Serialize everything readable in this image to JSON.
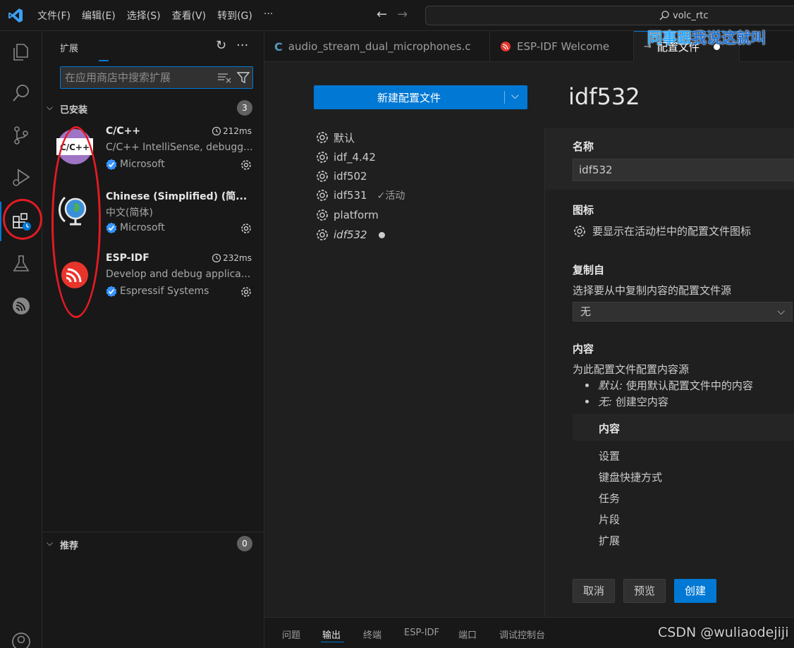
{
  "titlebar": {
    "menus": [
      "文件(F)",
      "编辑(E)",
      "选择(S)",
      "查看(V)",
      "转到(G)",
      "···"
    ],
    "back_arrow": "←",
    "forward_arrow": "→",
    "search_text": "volc_rtc",
    "logo_icon": "vscode-logo-icon"
  },
  "activitybar": {
    "items": [
      "explorer-icon",
      "search-icon",
      "source-control-icon",
      "run-debug-icon",
      "extensions-icon",
      "testing-icon",
      "espressif-icon",
      "account-icon"
    ],
    "active_color": "#0078d4"
  },
  "sidebar": {
    "title": "扩展",
    "refresh_icon": "↻",
    "more_icon": "···",
    "search_placeholder": "在应用商店中搜索扩展",
    "installed": {
      "label": "已安装",
      "count": "3",
      "items": [
        {
          "name": "C/C++",
          "time": "212ms",
          "desc": "C/C++ IntelliSense, debugg...",
          "publisher": "Microsoft",
          "icon_text": "C/C++"
        },
        {
          "name": "Chinese (Simplified) (简...",
          "time": "",
          "desc": "中文(简体)",
          "publisher": "Microsoft"
        },
        {
          "name": "ESP-IDF",
          "time": "232ms",
          "desc": "Develop and debug applica...",
          "publisher": "Espressif Systems"
        }
      ]
    },
    "recommended": {
      "label": "推荐",
      "count": "0"
    }
  },
  "tabs": [
    {
      "label": "audio_stream_dual_microphones.c",
      "icon": "C"
    },
    {
      "label": "ESP-IDF Welcome"
    },
    {
      "label": "配置文件"
    }
  ],
  "overlay": {
    "part1": "同事跟",
    "part2": "我说这就叫"
  },
  "editor": {
    "new_profile_button": "新建配置文件",
    "profiles": [
      {
        "name": "默认",
        "active_label": ""
      },
      {
        "name": "idf_4.42",
        "active_label": ""
      },
      {
        "name": "idf502",
        "active_label": ""
      },
      {
        "name": "idf531",
        "active_label": "活动"
      },
      {
        "name": "platform",
        "active_label": ""
      },
      {
        "name": "idf532",
        "active_label": ""
      }
    ],
    "check_mark": "✓",
    "title": "idf532",
    "name_label": "名称",
    "name_value": "idf532",
    "icon_label": "图标",
    "icon_desc": "要显示在活动栏中的配置文件图标",
    "copy_label": "复制自",
    "copy_desc": "选择要从中复制内容的配置文件源",
    "copy_value": "无",
    "contents_label": "内容",
    "contents_desc": "为此配置文件配置内容源",
    "bullet1_key": "默认:",
    "bullet1_text": " 使用默认配置文件中的内容",
    "bullet2_key": "无:",
    "bullet2_text": " 创建空内容",
    "contents_head": "内容",
    "contents_items": [
      "设置",
      "键盘快捷方式",
      "任务",
      "片段",
      "扩展"
    ],
    "cancel": "取消",
    "preview": "预览",
    "create": "创建"
  },
  "panel": {
    "tabs": [
      "问题",
      "输出",
      "终端",
      "ESP-IDF",
      "端口",
      "调试控制台"
    ],
    "active": "输出"
  },
  "watermark": "CSDN @wuliaodejiji"
}
